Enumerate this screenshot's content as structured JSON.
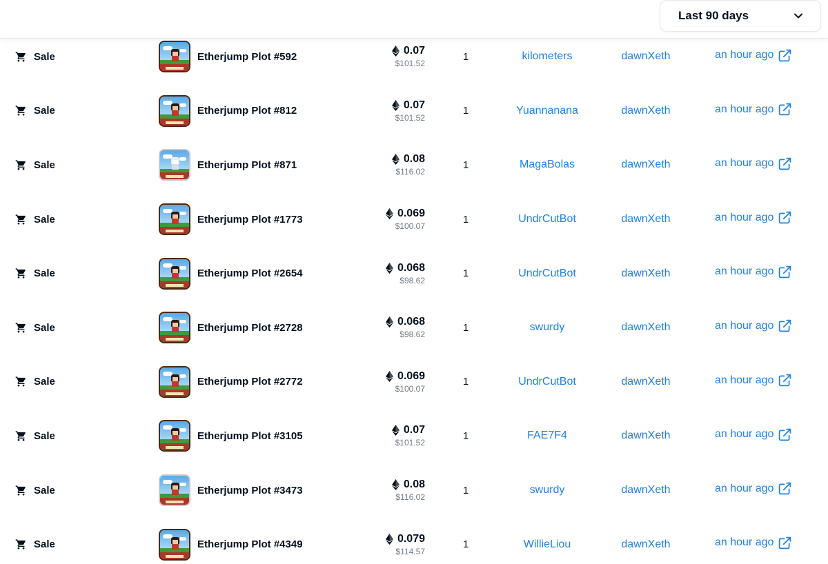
{
  "filter": {
    "label": "Last 90 days",
    "icon": "chevron-down-icon"
  },
  "colors": {
    "link": "#2081e2",
    "text": "#04111d",
    "muted": "#707a83"
  },
  "rows": [
    {
      "event": "Sale",
      "item": "Etherjump Plot #592",
      "eth": "0.07",
      "usd": "$101.52",
      "qty": "1",
      "from": "kilometers",
      "to": "dawnXeth",
      "time": "an hour ago"
    },
    {
      "event": "Sale",
      "item": "Etherjump Plot #812",
      "eth": "0.07",
      "usd": "$101.52",
      "qty": "1",
      "from": "Yuannanana",
      "to": "dawnXeth",
      "time": "an hour ago"
    },
    {
      "event": "Sale",
      "item": "Etherjump Plot #871",
      "eth": "0.08",
      "usd": "$116.02",
      "qty": "1",
      "from": "MagaBolas",
      "to": "dawnXeth",
      "time": "an hour ago"
    },
    {
      "event": "Sale",
      "item": "Etherjump Plot #1773",
      "eth": "0.069",
      "usd": "$100.07",
      "qty": "1",
      "from": "UndrCutBot",
      "to": "dawnXeth",
      "time": "an hour ago"
    },
    {
      "event": "Sale",
      "item": "Etherjump Plot #2654",
      "eth": "0.068",
      "usd": "$98.62",
      "qty": "1",
      "from": "UndrCutBot",
      "to": "dawnXeth",
      "time": "an hour ago"
    },
    {
      "event": "Sale",
      "item": "Etherjump Plot #2728",
      "eth": "0.068",
      "usd": "$98.62",
      "qty": "1",
      "from": "swurdy",
      "to": "dawnXeth",
      "time": "an hour ago"
    },
    {
      "event": "Sale",
      "item": "Etherjump Plot #2772",
      "eth": "0.069",
      "usd": "$100.07",
      "qty": "1",
      "from": "UndrCutBot",
      "to": "dawnXeth",
      "time": "an hour ago"
    },
    {
      "event": "Sale",
      "item": "Etherjump Plot #3105",
      "eth": "0.07",
      "usd": "$101.52",
      "qty": "1",
      "from": "FAE7F4",
      "to": "dawnXeth",
      "time": "an hour ago"
    },
    {
      "event": "Sale",
      "item": "Etherjump Plot #3473",
      "eth": "0.08",
      "usd": "$116.02",
      "qty": "1",
      "from": "swurdy",
      "to": "dawnXeth",
      "time": "an hour ago"
    },
    {
      "event": "Sale",
      "item": "Etherjump Plot #4349",
      "eth": "0.079",
      "usd": "$114.57",
      "qty": "1",
      "from": "WillieLiou",
      "to": "dawnXeth",
      "time": "an hour ago"
    }
  ]
}
